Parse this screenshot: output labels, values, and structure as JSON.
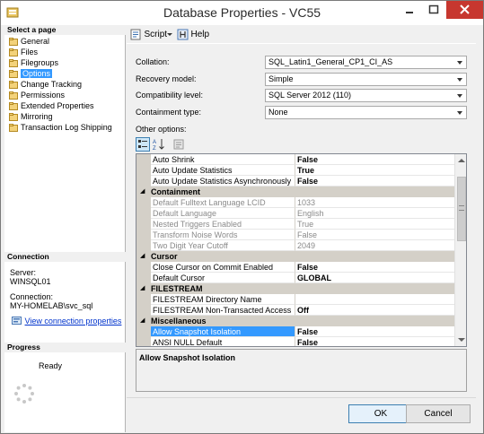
{
  "window": {
    "title": "Database Properties - VC55"
  },
  "sidebar": {
    "select_header": "Select a page",
    "pages": [
      {
        "label": "General",
        "selected": false
      },
      {
        "label": "Files",
        "selected": false
      },
      {
        "label": "Filegroups",
        "selected": false
      },
      {
        "label": "Options",
        "selected": true
      },
      {
        "label": "Change Tracking",
        "selected": false
      },
      {
        "label": "Permissions",
        "selected": false
      },
      {
        "label": "Extended Properties",
        "selected": false
      },
      {
        "label": "Mirroring",
        "selected": false
      },
      {
        "label": "Transaction Log Shipping",
        "selected": false
      }
    ],
    "connection_header": "Connection",
    "server_label": "Server:",
    "server_value": "WINSQL01",
    "connection_label": "Connection:",
    "connection_value": "MY-HOMELAB\\svc_sql",
    "view_connection_link": "View connection properties",
    "progress_header": "Progress",
    "progress_status": "Ready"
  },
  "toolbar": {
    "script_label": "Script",
    "help_label": "Help"
  },
  "form": {
    "collation": {
      "label": "Collation:",
      "value": "SQL_Latin1_General_CP1_CI_AS"
    },
    "recovery_model": {
      "label": "Recovery model:",
      "value": "Simple"
    },
    "compatibility_level": {
      "label": "Compatibility level:",
      "value": "SQL Server 2012 (110)"
    },
    "containment_type": {
      "label": "Containment type:",
      "value": "None"
    },
    "other_options_label": "Other options:"
  },
  "grid": {
    "rows": [
      {
        "kind": "prop",
        "name": "Auto Shrink",
        "value": "False"
      },
      {
        "kind": "prop",
        "name": "Auto Update Statistics",
        "value": "True"
      },
      {
        "kind": "prop",
        "name": "Auto Update Statistics Asynchronously",
        "value": "False"
      },
      {
        "kind": "cat",
        "name": "Containment"
      },
      {
        "kind": "prop",
        "name": "Default Fulltext Language LCID",
        "value": "1033",
        "disabled": true
      },
      {
        "kind": "prop",
        "name": "Default Language",
        "value": "English",
        "disabled": true
      },
      {
        "kind": "prop",
        "name": "Nested Triggers Enabled",
        "value": "True",
        "disabled": true
      },
      {
        "kind": "prop",
        "name": "Transform Noise Words",
        "value": "False",
        "disabled": true
      },
      {
        "kind": "prop",
        "name": "Two Digit Year Cutoff",
        "value": "2049",
        "disabled": true
      },
      {
        "kind": "cat",
        "name": "Cursor"
      },
      {
        "kind": "prop",
        "name": "Close Cursor on Commit Enabled",
        "value": "False"
      },
      {
        "kind": "prop",
        "name": "Default Cursor",
        "value": "GLOBAL"
      },
      {
        "kind": "cat",
        "name": "FILESTREAM"
      },
      {
        "kind": "prop",
        "name": "FILESTREAM Directory Name",
        "value": ""
      },
      {
        "kind": "prop",
        "name": "FILESTREAM Non-Transacted Access",
        "value": "Off"
      },
      {
        "kind": "cat",
        "name": "Miscellaneous"
      },
      {
        "kind": "prop",
        "name": "Allow Snapshot Isolation",
        "value": "False",
        "selected": true
      },
      {
        "kind": "prop",
        "name": "ANSI NULL Default",
        "value": "False"
      }
    ],
    "description": "Allow Snapshot Isolation"
  },
  "buttons": {
    "ok": "OK",
    "cancel": "Cancel"
  },
  "colors": {
    "selection": "#3399ff",
    "close_button": "#c7372f",
    "category_row": "#d4d0c8"
  }
}
